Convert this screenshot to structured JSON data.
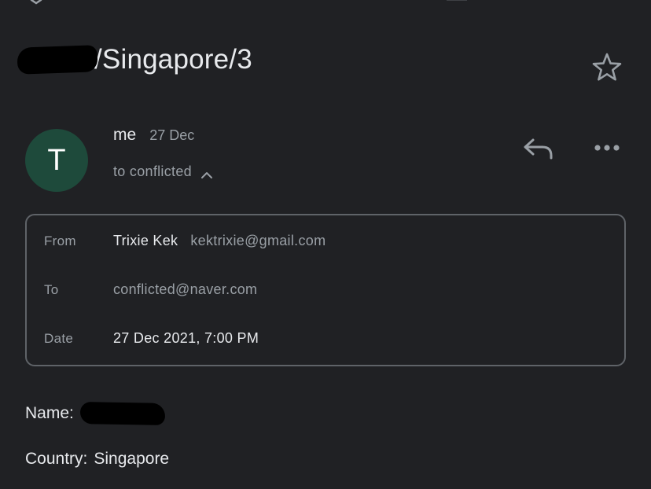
{
  "subject": {
    "text": "/Singapore/3"
  },
  "sender": {
    "avatar_letter": "T",
    "name": "me",
    "date": "27 Dec",
    "recipient_summary": "to conflicted"
  },
  "details": {
    "from_label": "From",
    "from_name": "Trixie Kek",
    "from_email": "kektrixie@gmail.com",
    "to_label": "To",
    "to_email": "conflicted@naver.com",
    "date_label": "Date",
    "date_value": "27 Dec 2021, 7:00 PM"
  },
  "body": {
    "name_label": "Name:",
    "country_label": "Country:",
    "country_value": "Singapore"
  },
  "colors": {
    "background": "#202124",
    "avatar": "#1e4a3b",
    "text_primary": "#e8eaed",
    "text_secondary": "#9aa0a6",
    "border": "#5f6368"
  },
  "icons": [
    "back-arrow-icon",
    "top-toolbar-icon",
    "star-icon",
    "chevron-up-icon",
    "reply-icon",
    "more-icon"
  ]
}
